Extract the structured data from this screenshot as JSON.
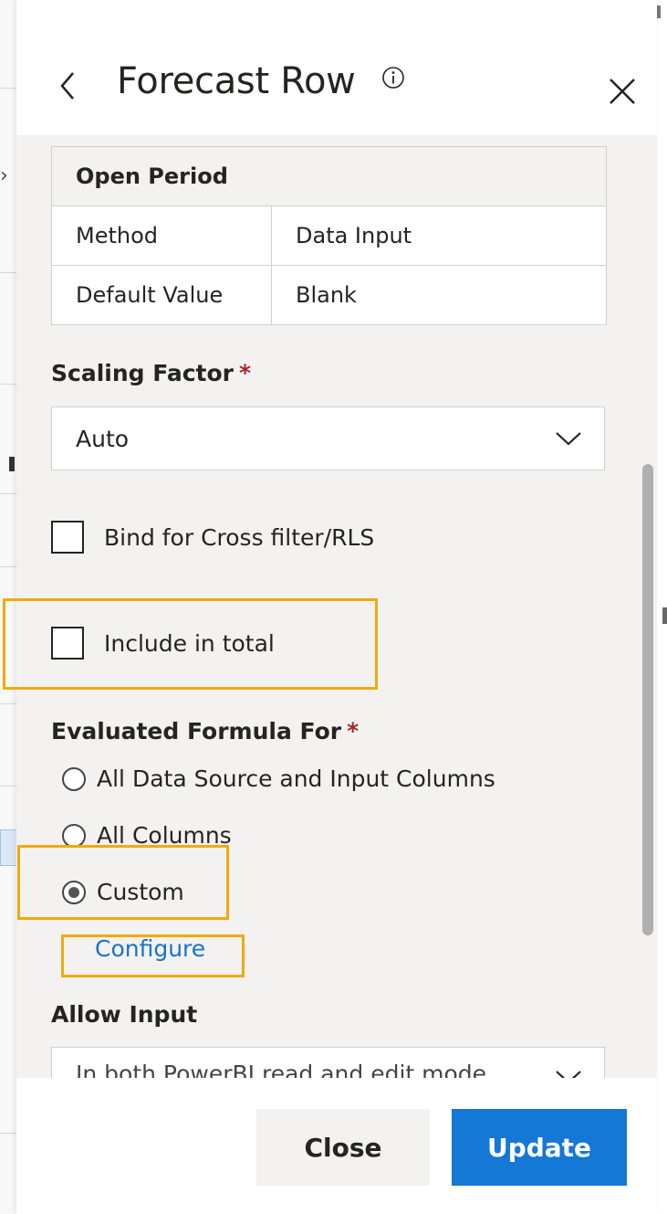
{
  "panel": {
    "title": "Forecast Row"
  },
  "open_period": {
    "heading": "Open Period",
    "rows": [
      {
        "key": "Method",
        "value": "Data Input"
      },
      {
        "key": "Default Value",
        "value": "Blank"
      }
    ]
  },
  "scaling_factor": {
    "label": "Scaling Factor",
    "required_mark": "*",
    "value": "Auto"
  },
  "bind_cross_filter": {
    "label": "Bind for Cross filter/RLS",
    "checked": false
  },
  "include_in_total": {
    "label": "Include in total",
    "checked": false
  },
  "evaluated_formula": {
    "label": "Evaluated Formula For",
    "required_mark": "*",
    "options": [
      {
        "label": "All Data Source and Input Columns",
        "checked": false
      },
      {
        "label": "All Columns",
        "checked": false
      },
      {
        "label": "Custom",
        "checked": true
      }
    ],
    "configure_link": "Configure"
  },
  "allow_input": {
    "label": "Allow Input",
    "value": "In both PowerBI read and edit mode"
  },
  "footer": {
    "close_label": "Close",
    "update_label": "Update"
  },
  "colors": {
    "accent": "#1577d6",
    "highlight": "#f0a90f",
    "required": "#a4262c",
    "link": "#1a73c7"
  }
}
